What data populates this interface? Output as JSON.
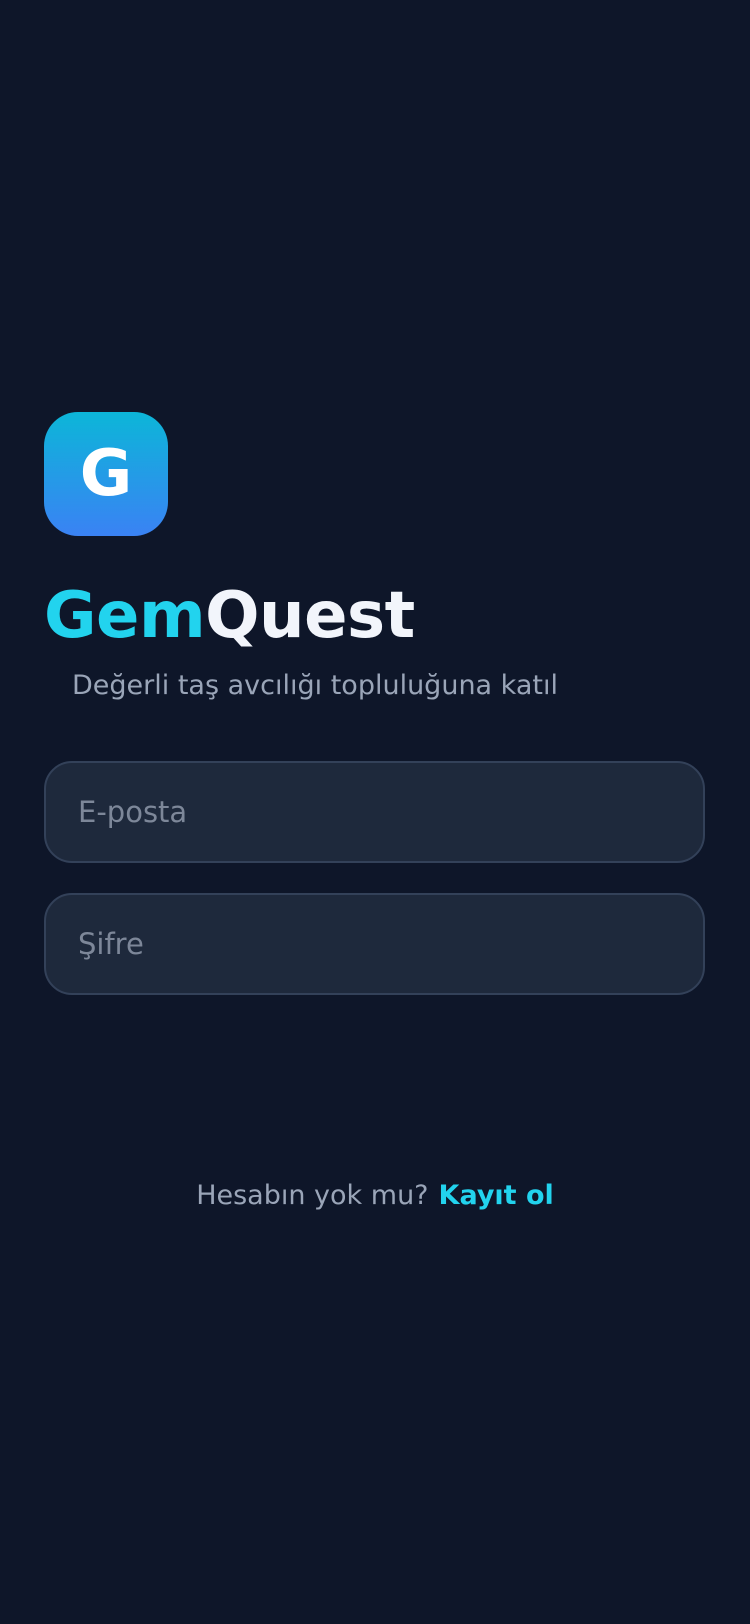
{
  "app": {
    "logo_letter": "G",
    "title_part1": "Gem",
    "title_part2": "Quest",
    "subtitle": "Değerli taş avcılığı topluluğuna katıl"
  },
  "form": {
    "email": {
      "placeholder": "E-posta",
      "value": ""
    },
    "password": {
      "placeholder": "Şifre",
      "value": ""
    }
  },
  "signup": {
    "prompt": "Hesabın yok mu?",
    "link_label": "Kayıt ol"
  },
  "colors": {
    "background": "#0e1629",
    "accent": "#22d3ee",
    "field_background": "#1e293c",
    "field_border": "#334159",
    "muted_text": "#9aa5b8"
  }
}
